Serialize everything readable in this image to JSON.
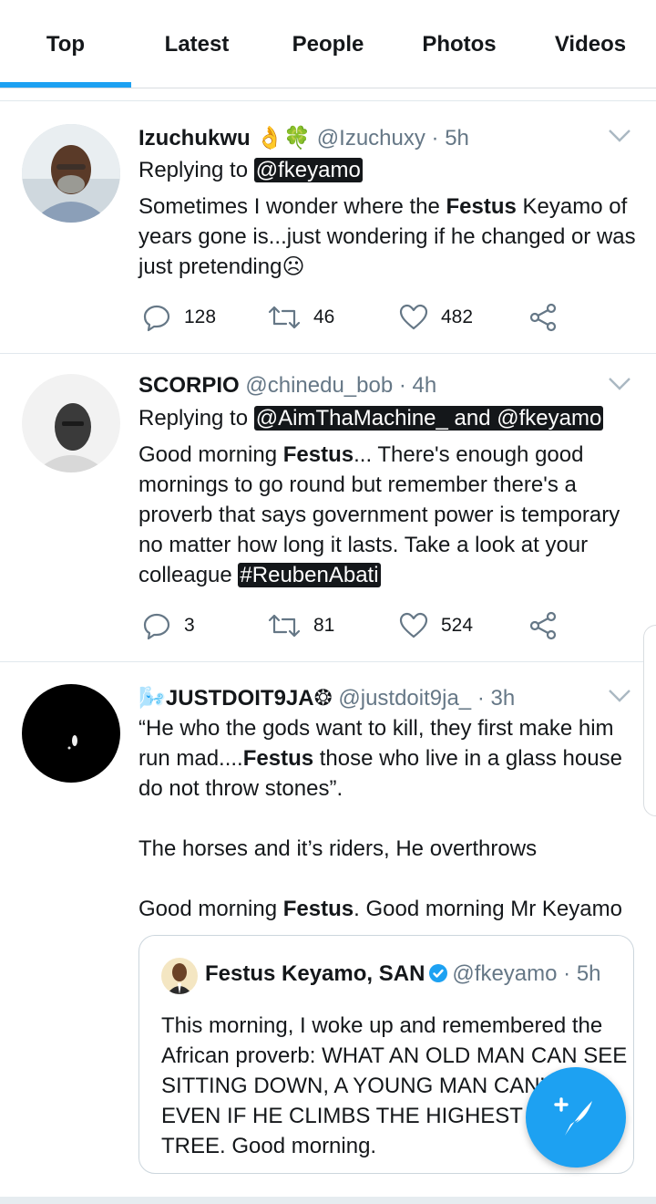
{
  "tabs": [
    {
      "label": "Top",
      "active": true
    },
    {
      "label": "Latest",
      "active": false
    },
    {
      "label": "People",
      "active": false
    },
    {
      "label": "Photos",
      "active": false
    },
    {
      "label": "Videos",
      "active": false
    }
  ],
  "colors": {
    "accent": "#1da1f2",
    "text": "#14171a",
    "muted": "#657786",
    "divider": "#e1e8ed"
  },
  "tweets": [
    {
      "name": "Izuchukwu",
      "name_emoji": "👌🍀",
      "handle": "@Izuchuxy",
      "time": "· 5h",
      "replying_prefix": "Replying to",
      "replying_to": "@fkeyamo",
      "body_a": "Sometimes I wonder where the ",
      "body_bold": "Festus",
      "body_b": " Keyamo of years gone is...just wondering if he changed or was just pretending☹",
      "replies": "128",
      "retweets": "46",
      "likes": "482"
    },
    {
      "name": "SCORPIO",
      "handle": "@chinedu_bob",
      "time": "· 4h",
      "replying_prefix": "Replying to",
      "replying_to": "@AimThaMachine_ and @fkeyamo",
      "body_a": "Good morning ",
      "body_bold": "Festus",
      "body_b": "... There's enough good mornings to go round but remember there's a proverb that says government power is temporary no matter how long it lasts. Take a look at your colleague ",
      "hashtag": "#ReubenAbati",
      "replies": "3",
      "retweets": "81",
      "likes": "524"
    },
    {
      "name_prefix": "🌬️",
      "name": "JUSTDOIT9JA",
      "name_suffix": "❂",
      "handle": "@justdoit9ja_",
      "time": "· 3h",
      "body_1a": "“He who the gods want to kill, they first make him run mad....",
      "body_1bold": "Festus",
      "body_1b": " those who live in a glass house do not throw stones”.",
      "body_2": "The horses and it’s riders, He overthrows",
      "body_3a": "Good morning ",
      "body_3bold": "Festus",
      "body_3b": ". Good morning Mr Keyamo",
      "quote": {
        "name": "Festus Keyamo, SAN",
        "handle": "@fkeyamo",
        "time": "· 5h",
        "body": "This morning, I woke up and remembered the African proverb: WHAT AN OLD MAN CAN SEE SITTING DOWN, A YOUNG MAN CAN’T SEE EVEN IF HE CLIMBS THE HIGHEST IROKO TREE. Good morning."
      }
    }
  ],
  "fab": {
    "icon": "compose-tweet-icon"
  }
}
